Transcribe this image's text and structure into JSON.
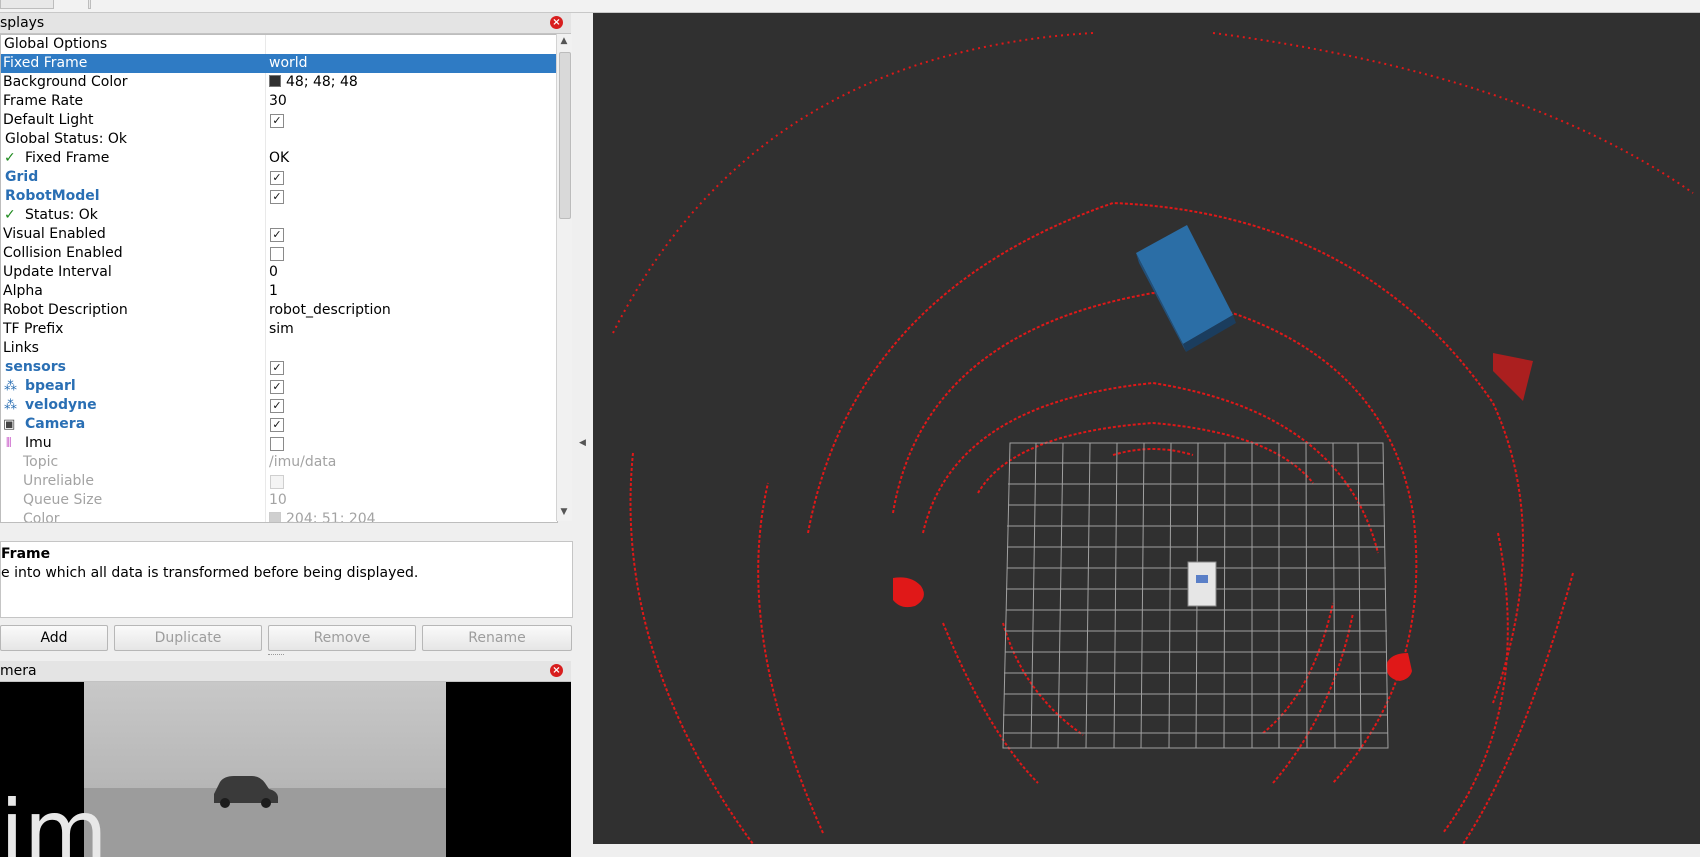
{
  "displays_panel": {
    "title": "splays",
    "rows": [
      {
        "label": "Global Options",
        "value": ""
      },
      {
        "label": "Fixed Frame",
        "value": "world"
      },
      {
        "label": "Background Color",
        "value": "48; 48; 48"
      },
      {
        "label": "Frame Rate",
        "value": "30"
      },
      {
        "label": "Default Light",
        "value": ""
      },
      {
        "label": "Global Status: Ok",
        "value": ""
      },
      {
        "label": "Fixed Frame",
        "value": "OK"
      },
      {
        "label": "Grid",
        "value": ""
      },
      {
        "label": "RobotModel",
        "value": ""
      },
      {
        "label": "Status: Ok",
        "value": ""
      },
      {
        "label": "Visual Enabled",
        "value": ""
      },
      {
        "label": "Collision Enabled",
        "value": ""
      },
      {
        "label": "Update Interval",
        "value": "0"
      },
      {
        "label": "Alpha",
        "value": "1"
      },
      {
        "label": "Robot Description",
        "value": "robot_description"
      },
      {
        "label": "TF Prefix",
        "value": "sim"
      },
      {
        "label": "Links",
        "value": ""
      },
      {
        "label": "sensors",
        "value": ""
      },
      {
        "label": "bpearl",
        "value": ""
      },
      {
        "label": "velodyne",
        "value": ""
      },
      {
        "label": "Camera",
        "value": ""
      },
      {
        "label": "Imu",
        "value": ""
      },
      {
        "label": "Topic",
        "value": "/imu/data"
      },
      {
        "label": "Unreliable",
        "value": ""
      },
      {
        "label": "Queue Size",
        "value": "10"
      },
      {
        "label": "Color",
        "value": "204; 51; 204"
      }
    ]
  },
  "description": {
    "heading": "Frame",
    "text": "e into which all data is transformed before being displayed."
  },
  "buttons": {
    "add": "Add",
    "duplicate": "Duplicate",
    "remove": "Remove",
    "rename": "Rename"
  },
  "camera_panel": {
    "title": "mera",
    "overlay_text": "im"
  },
  "colors": {
    "selection": "#2f7bc4",
    "viewport_background": "#303030",
    "laser_points": "#e01818",
    "box": "#2b6ea6",
    "grid": "#a0a0a0"
  }
}
